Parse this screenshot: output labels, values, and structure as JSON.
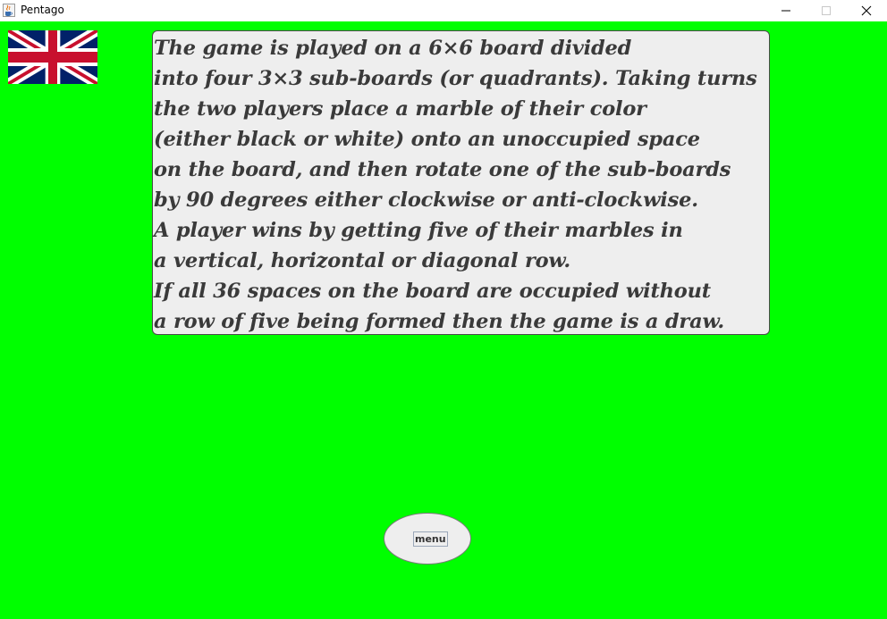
{
  "window": {
    "title": "Pentago",
    "icon": "java-cup-icon",
    "controls": [
      "minimize-icon",
      "maximize-icon",
      "close-icon"
    ]
  },
  "language_flag": {
    "icon": "uk-flag-icon"
  },
  "rules": {
    "lines": [
      "The game is played on a 6×6 board divided",
      "into four 3×3 sub-boards (or quadrants). Taking turns",
      "the two players place a marble of their color",
      "(either black or white) onto an unoccupied space",
      "on the board, and then rotate one of the sub-boards",
      "by 90 degrees either clockwise or anti-clockwise.",
      "A player wins by getting five of their marbles in",
      "a vertical, horizontal or diagonal row.",
      "If all 36 spaces on the board are occupied without",
      "a row of five being formed then the game is a draw."
    ]
  },
  "menu": {
    "label": "menu"
  },
  "colors": {
    "background": "#00ff00",
    "panel": "#eeeeee",
    "text": "#3a3a3a",
    "flag_blue": "#012169",
    "flag_red": "#c8102e"
  }
}
